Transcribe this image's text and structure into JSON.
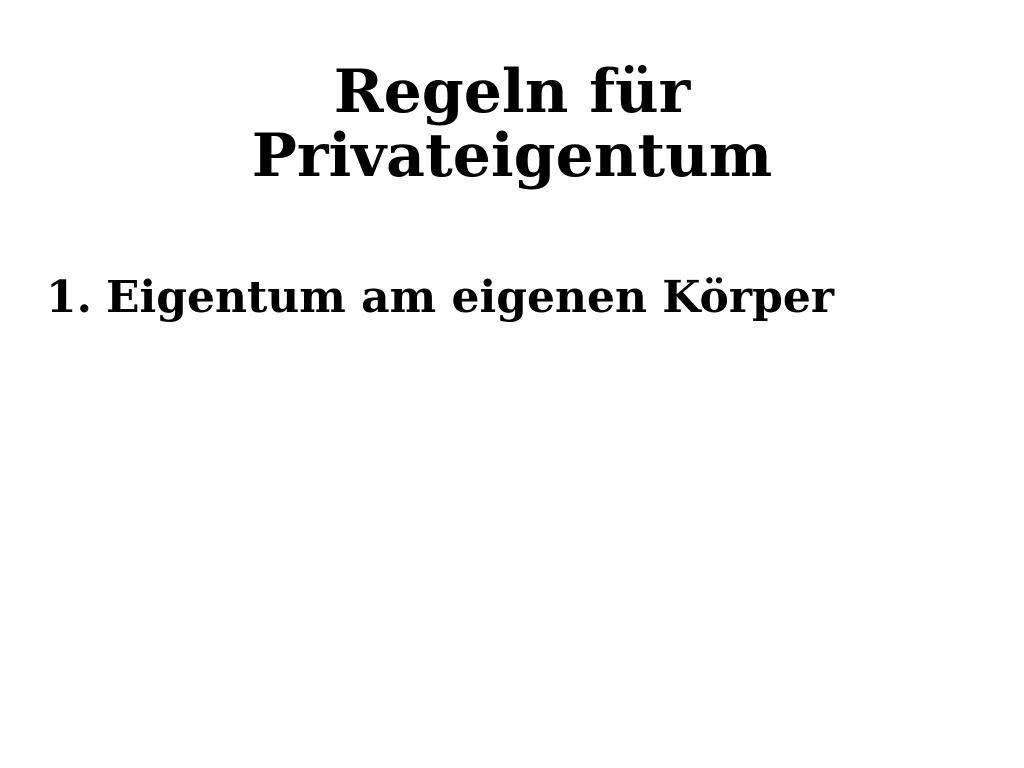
{
  "slide": {
    "title_line1": "Regeln für",
    "title_line2": "Privateigentum",
    "items": [
      {
        "number": "1.",
        "text": "Eigentum am eigenen Körper"
      }
    ]
  }
}
